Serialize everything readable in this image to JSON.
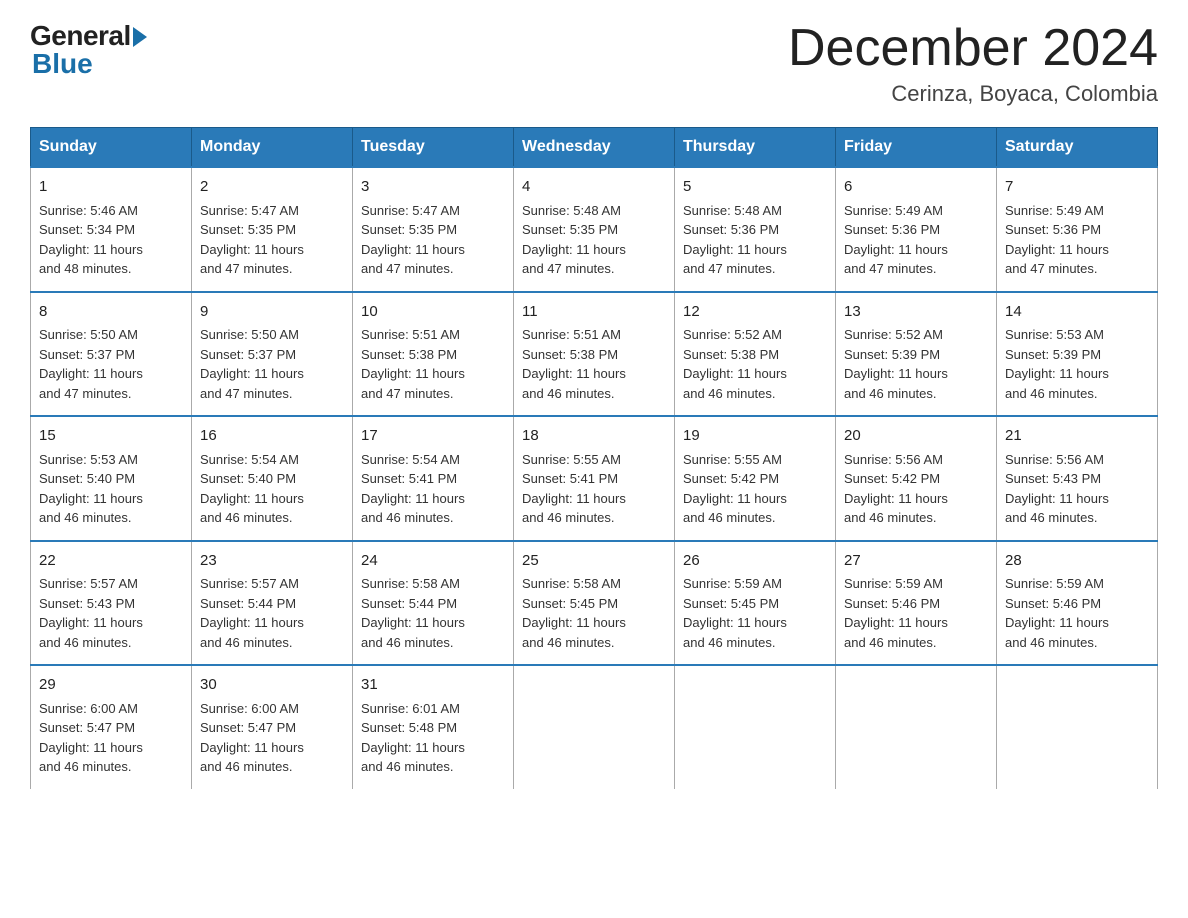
{
  "logo": {
    "general": "General",
    "blue": "Blue"
  },
  "header": {
    "month": "December 2024",
    "location": "Cerinza, Boyaca, Colombia"
  },
  "days_of_week": [
    "Sunday",
    "Monday",
    "Tuesday",
    "Wednesday",
    "Thursday",
    "Friday",
    "Saturday"
  ],
  "weeks": [
    [
      {
        "day": "1",
        "sunrise": "5:46 AM",
        "sunset": "5:34 PM",
        "daylight": "11 hours and 48 minutes."
      },
      {
        "day": "2",
        "sunrise": "5:47 AM",
        "sunset": "5:35 PM",
        "daylight": "11 hours and 47 minutes."
      },
      {
        "day": "3",
        "sunrise": "5:47 AM",
        "sunset": "5:35 PM",
        "daylight": "11 hours and 47 minutes."
      },
      {
        "day": "4",
        "sunrise": "5:48 AM",
        "sunset": "5:35 PM",
        "daylight": "11 hours and 47 minutes."
      },
      {
        "day": "5",
        "sunrise": "5:48 AM",
        "sunset": "5:36 PM",
        "daylight": "11 hours and 47 minutes."
      },
      {
        "day": "6",
        "sunrise": "5:49 AM",
        "sunset": "5:36 PM",
        "daylight": "11 hours and 47 minutes."
      },
      {
        "day": "7",
        "sunrise": "5:49 AM",
        "sunset": "5:36 PM",
        "daylight": "11 hours and 47 minutes."
      }
    ],
    [
      {
        "day": "8",
        "sunrise": "5:50 AM",
        "sunset": "5:37 PM",
        "daylight": "11 hours and 47 minutes."
      },
      {
        "day": "9",
        "sunrise": "5:50 AM",
        "sunset": "5:37 PM",
        "daylight": "11 hours and 47 minutes."
      },
      {
        "day": "10",
        "sunrise": "5:51 AM",
        "sunset": "5:38 PM",
        "daylight": "11 hours and 47 minutes."
      },
      {
        "day": "11",
        "sunrise": "5:51 AM",
        "sunset": "5:38 PM",
        "daylight": "11 hours and 46 minutes."
      },
      {
        "day": "12",
        "sunrise": "5:52 AM",
        "sunset": "5:38 PM",
        "daylight": "11 hours and 46 minutes."
      },
      {
        "day": "13",
        "sunrise": "5:52 AM",
        "sunset": "5:39 PM",
        "daylight": "11 hours and 46 minutes."
      },
      {
        "day": "14",
        "sunrise": "5:53 AM",
        "sunset": "5:39 PM",
        "daylight": "11 hours and 46 minutes."
      }
    ],
    [
      {
        "day": "15",
        "sunrise": "5:53 AM",
        "sunset": "5:40 PM",
        "daylight": "11 hours and 46 minutes."
      },
      {
        "day": "16",
        "sunrise": "5:54 AM",
        "sunset": "5:40 PM",
        "daylight": "11 hours and 46 minutes."
      },
      {
        "day": "17",
        "sunrise": "5:54 AM",
        "sunset": "5:41 PM",
        "daylight": "11 hours and 46 minutes."
      },
      {
        "day": "18",
        "sunrise": "5:55 AM",
        "sunset": "5:41 PM",
        "daylight": "11 hours and 46 minutes."
      },
      {
        "day": "19",
        "sunrise": "5:55 AM",
        "sunset": "5:42 PM",
        "daylight": "11 hours and 46 minutes."
      },
      {
        "day": "20",
        "sunrise": "5:56 AM",
        "sunset": "5:42 PM",
        "daylight": "11 hours and 46 minutes."
      },
      {
        "day": "21",
        "sunrise": "5:56 AM",
        "sunset": "5:43 PM",
        "daylight": "11 hours and 46 minutes."
      }
    ],
    [
      {
        "day": "22",
        "sunrise": "5:57 AM",
        "sunset": "5:43 PM",
        "daylight": "11 hours and 46 minutes."
      },
      {
        "day": "23",
        "sunrise": "5:57 AM",
        "sunset": "5:44 PM",
        "daylight": "11 hours and 46 minutes."
      },
      {
        "day": "24",
        "sunrise": "5:58 AM",
        "sunset": "5:44 PM",
        "daylight": "11 hours and 46 minutes."
      },
      {
        "day": "25",
        "sunrise": "5:58 AM",
        "sunset": "5:45 PM",
        "daylight": "11 hours and 46 minutes."
      },
      {
        "day": "26",
        "sunrise": "5:59 AM",
        "sunset": "5:45 PM",
        "daylight": "11 hours and 46 minutes."
      },
      {
        "day": "27",
        "sunrise": "5:59 AM",
        "sunset": "5:46 PM",
        "daylight": "11 hours and 46 minutes."
      },
      {
        "day": "28",
        "sunrise": "5:59 AM",
        "sunset": "5:46 PM",
        "daylight": "11 hours and 46 minutes."
      }
    ],
    [
      {
        "day": "29",
        "sunrise": "6:00 AM",
        "sunset": "5:47 PM",
        "daylight": "11 hours and 46 minutes."
      },
      {
        "day": "30",
        "sunrise": "6:00 AM",
        "sunset": "5:47 PM",
        "daylight": "11 hours and 46 minutes."
      },
      {
        "day": "31",
        "sunrise": "6:01 AM",
        "sunset": "5:48 PM",
        "daylight": "11 hours and 46 minutes."
      },
      null,
      null,
      null,
      null
    ]
  ],
  "labels": {
    "sunrise": "Sunrise:",
    "sunset": "Sunset:",
    "daylight": "Daylight:"
  }
}
